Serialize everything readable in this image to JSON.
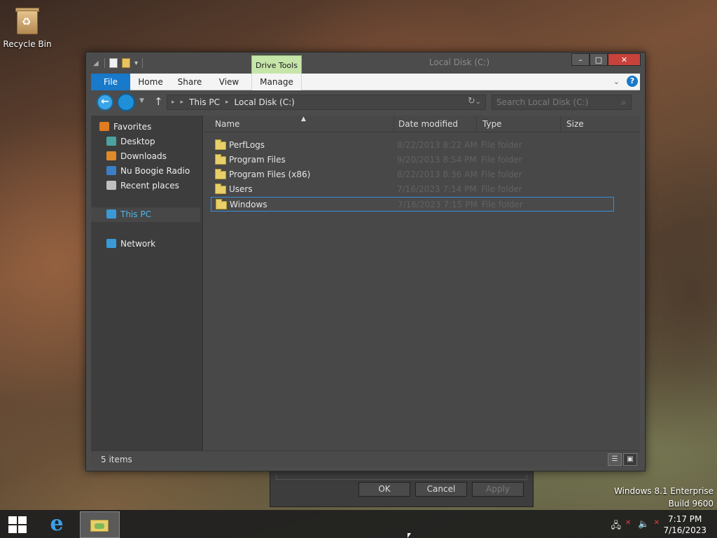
{
  "desktop": {
    "recycle_bin_label": "Recycle Bin"
  },
  "background_dialog": {
    "ok_label": "OK",
    "cancel_label": "Cancel",
    "apply_label": "Apply"
  },
  "window": {
    "title": "Local Disk (C:)",
    "contextual_tab": "Drive Tools",
    "controls": {
      "minimize": "–",
      "maximize": "□",
      "close": "✕"
    }
  },
  "ribbon": {
    "tabs": [
      "File",
      "Home",
      "Share",
      "View",
      "Manage"
    ],
    "help": "?"
  },
  "addressbar": {
    "crumbs": [
      "This PC",
      "Local Disk (C:)"
    ]
  },
  "search": {
    "placeholder": "Search Local Disk (C:)"
  },
  "navpane": {
    "favorites": "Favorites",
    "desktop": "Desktop",
    "downloads": "Downloads",
    "nu_boogie": "Nu Boogie Radio",
    "recent": "Recent places",
    "this_pc": "This PC",
    "network": "Network"
  },
  "columns": {
    "name": "Name",
    "date": "Date modified",
    "type": "Type",
    "size": "Size"
  },
  "files": [
    {
      "name": "PerfLogs",
      "date": "8/22/2013 8:22 AM",
      "type": "File folder"
    },
    {
      "name": "Program Files",
      "date": "9/20/2013 8:54 PM",
      "type": "File folder"
    },
    {
      "name": "Program Files (x86)",
      "date": "8/22/2013 8:36 AM",
      "type": "File folder"
    },
    {
      "name": "Users",
      "date": "7/16/2023 7:14 PM",
      "type": "File folder"
    },
    {
      "name": "Windows",
      "date": "7/16/2023 7:15 PM",
      "type": "File folder"
    }
  ],
  "statusbar": {
    "count": "5 items"
  },
  "watermark": {
    "line1": "Windows 8.1 Enterprise",
    "line2": "Build 9600"
  },
  "clock": {
    "time": "7:17 PM",
    "date": "7/16/2023"
  },
  "colors": {
    "accent": "#1979ca",
    "drive_tools": "#c6e5a9",
    "close": "#c7423a",
    "selection": "#3a8fd8"
  }
}
